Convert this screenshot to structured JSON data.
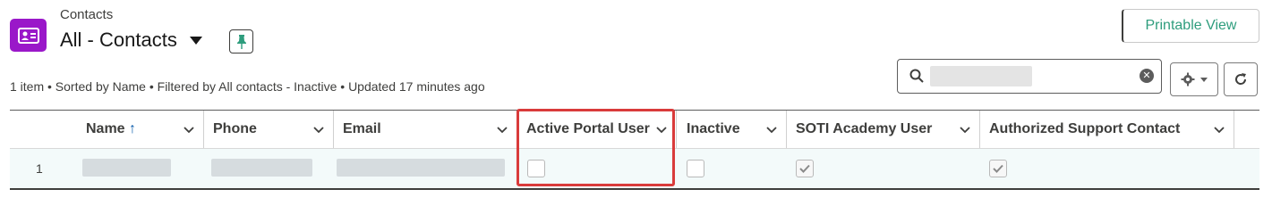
{
  "header": {
    "object_label": "Contacts",
    "list_view_name": "All - Contacts",
    "printable_view_label": "Printable View"
  },
  "status": {
    "meta_text": "1 item • Sorted by Name • Filtered by All contacts - Inactive • Updated 17 minutes ago"
  },
  "table": {
    "columns": [
      {
        "label": "Name",
        "sort": "↑"
      },
      {
        "label": "Phone"
      },
      {
        "label": "Email"
      },
      {
        "label": "Active Portal User"
      },
      {
        "label": "Inactive"
      },
      {
        "label": "SOTI Academy User"
      },
      {
        "label": "Authorized Support Contact"
      }
    ],
    "rows": [
      {
        "row_number": "1",
        "active_portal_user": false,
        "inactive": false,
        "soti_academy_user": true,
        "authorized_support_contact": true
      }
    ]
  },
  "colors": {
    "object_icon": "#9a18c9",
    "accent_green": "#2e9d7d",
    "highlight_red": "#d93b3b",
    "row_bg": "#f3fafa"
  },
  "icons": [
    "contact-card-icon",
    "dropdown-caret-icon",
    "pin-icon",
    "search-icon",
    "clear-icon",
    "gear-icon",
    "refresh-icon",
    "chevron-down-icon",
    "checkmark-icon"
  ]
}
